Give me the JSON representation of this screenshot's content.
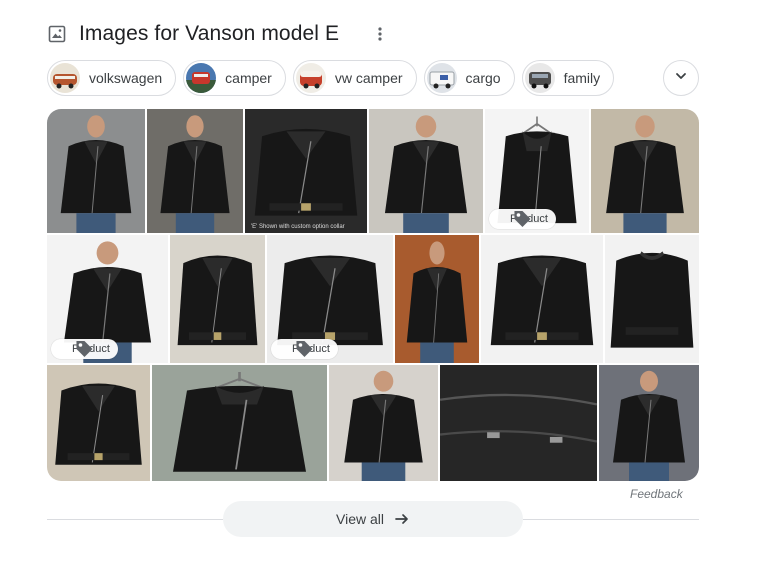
{
  "header": {
    "title": "Images for Vanson model E",
    "image_icon": "image-icon",
    "more_icon": "more-vert-icon"
  },
  "chips": [
    {
      "label": "volkswagen",
      "thumb_color": "#b5562f"
    },
    {
      "label": "camper",
      "thumb_color": "#1f4e8c"
    },
    {
      "label": "vw camper",
      "thumb_color": "#c6402b"
    },
    {
      "label": "cargo",
      "thumb_color": "#c9ced6"
    },
    {
      "label": "family",
      "thumb_color": "#5a5a5a"
    }
  ],
  "expand_icon": "chevron-down-icon",
  "tiles": [
    {
      "scene": "person",
      "bg": "#8c8e8f"
    },
    {
      "scene": "person",
      "bg": "#6f6d68"
    },
    {
      "scene": "flat",
      "bg": "#2a2a2a",
      "caption": "'E' Shown with custom option collar"
    },
    {
      "scene": "person",
      "bg": "#c9c6bf"
    },
    {
      "scene": "hanger",
      "bg": "#f4f4f4",
      "badge": "Product"
    },
    {
      "scene": "person",
      "bg": "#c2b9a7"
    },
    {
      "scene": "person",
      "bg": "#f3f3f3",
      "badge": "Product"
    },
    {
      "scene": "flat",
      "bg": "#d8d4cb"
    },
    {
      "scene": "flat",
      "bg": "#ececec",
      "badge": "Product"
    },
    {
      "scene": "person",
      "bg": "#a85b2e"
    },
    {
      "scene": "flat",
      "bg": "#f2f2f2"
    },
    {
      "scene": "back",
      "bg": "#f2f2f2"
    },
    {
      "scene": "flat",
      "bg": "#cfc6b6"
    },
    {
      "scene": "hanger",
      "bg": "#9aa39a"
    },
    {
      "scene": "person",
      "bg": "#d6d2cc"
    },
    {
      "scene": "closeup",
      "bg": "#3a3a3a"
    },
    {
      "scene": "person",
      "bg": "#6e7179"
    }
  ],
  "feedback": "Feedback",
  "view_all": {
    "label": "View all",
    "icon": "arrow-right-icon"
  },
  "colors": {
    "chip_border": "#dadce0",
    "button_bg": "#f1f3f4",
    "leather": "#171717"
  }
}
